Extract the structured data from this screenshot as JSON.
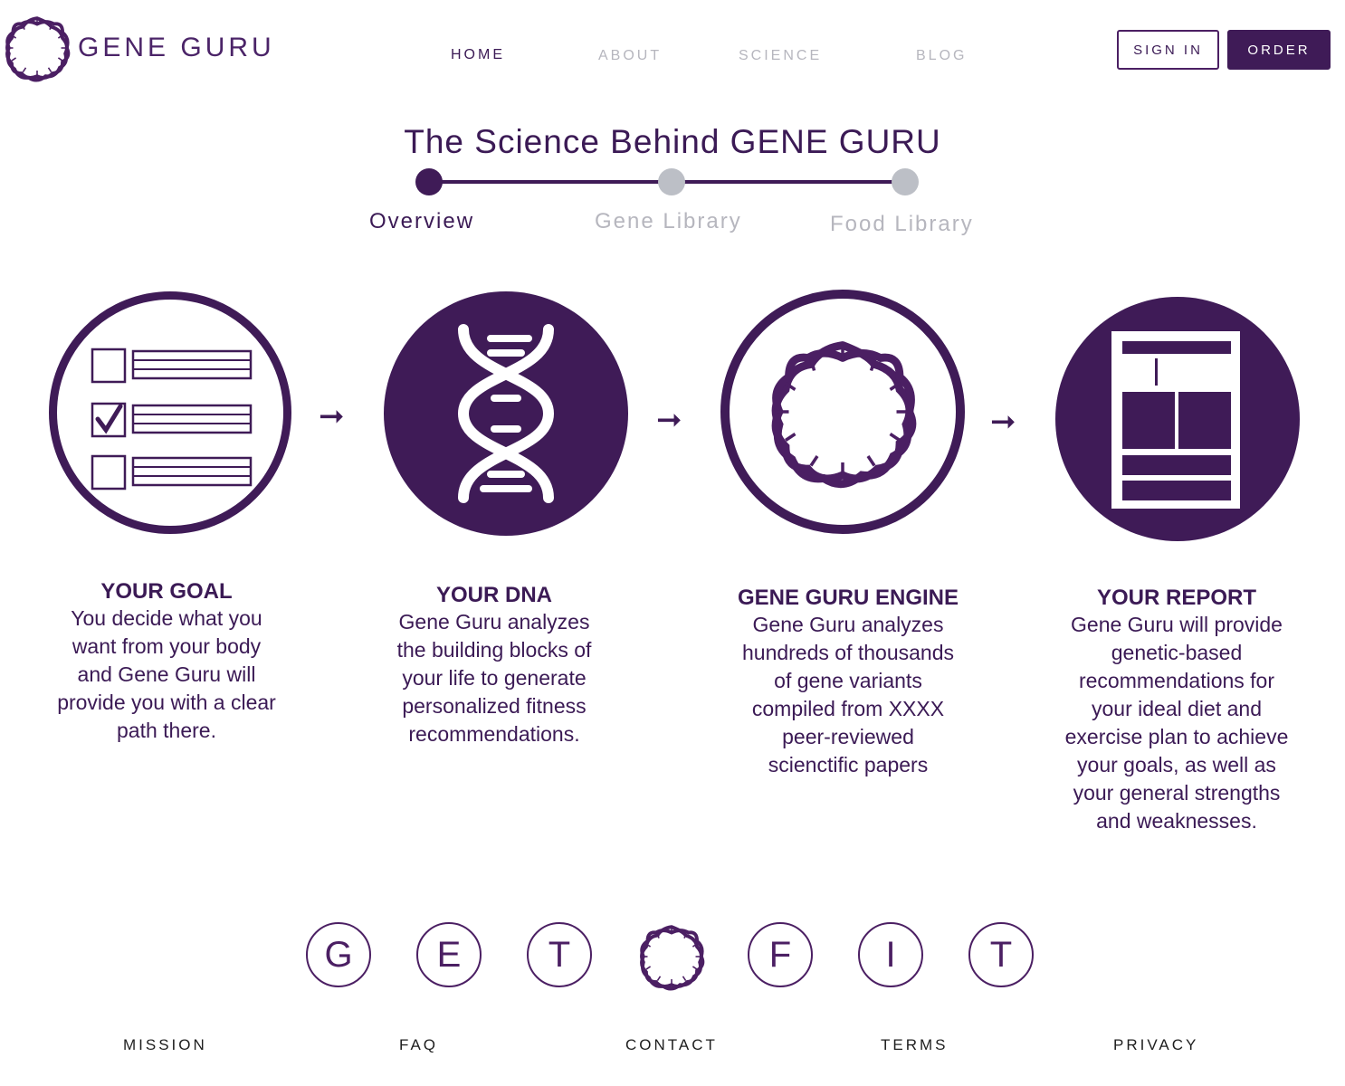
{
  "brand": {
    "name": "GENE GURU"
  },
  "nav": {
    "items": [
      {
        "label": "HOME"
      },
      {
        "label": "ABOUT"
      },
      {
        "label": "SCIENCE"
      },
      {
        "label": "BLOG"
      }
    ]
  },
  "auth": {
    "sign_in_label": "SIGN IN",
    "order_label": "ORDER"
  },
  "page": {
    "title": "The Science Behind GENE GURU"
  },
  "stepper": {
    "steps": [
      {
        "label": "Overview",
        "state": "active"
      },
      {
        "label": "Gene Library",
        "state": "inactive"
      },
      {
        "label": "Food Library",
        "state": "inactive"
      }
    ]
  },
  "process": [
    {
      "title": "YOUR GOAL",
      "lines": [
        "You decide what you",
        "want from your body",
        "and Gene Guru will",
        "provide you with a clear",
        "path there."
      ],
      "icon": "checklist-icon"
    },
    {
      "title": "YOUR DNA",
      "lines": [
        "Gene Guru analyzes",
        "the building blocks of",
        "your life to generate",
        "personalized fitness",
        "recommendations."
      ],
      "icon": "dna-helix-icon"
    },
    {
      "title": "GENE GURU ENGINE",
      "lines": [
        "Gene Guru  analyzes",
        "hundreds of thousands",
        "of gene variants",
        "compiled from XXXX",
        "peer-reviewed",
        "scienctific papers"
      ],
      "icon": "dna-ring-icon"
    },
    {
      "title": "YOUR REPORT",
      "lines": [
        "Gene Guru will provide",
        "genetic-based",
        "recommendations for",
        "your ideal diet and",
        "exercise plan to achieve",
        "your goals, as well as",
        "your general strengths",
        "and weaknesses."
      ],
      "icon": "report-icon"
    }
  ],
  "getfit": {
    "letters": [
      "G",
      "E",
      "T",
      "F",
      "I",
      "T"
    ]
  },
  "footer": {
    "links": [
      {
        "label": "MISSION"
      },
      {
        "label": "FAQ"
      },
      {
        "label": "CONTACT"
      },
      {
        "label": "TERMS"
      },
      {
        "label": "PRIVACY"
      }
    ]
  },
  "colors": {
    "primary": "#3f1b57",
    "inactive": "#bcbfc6",
    "text": "#3b1a55"
  }
}
